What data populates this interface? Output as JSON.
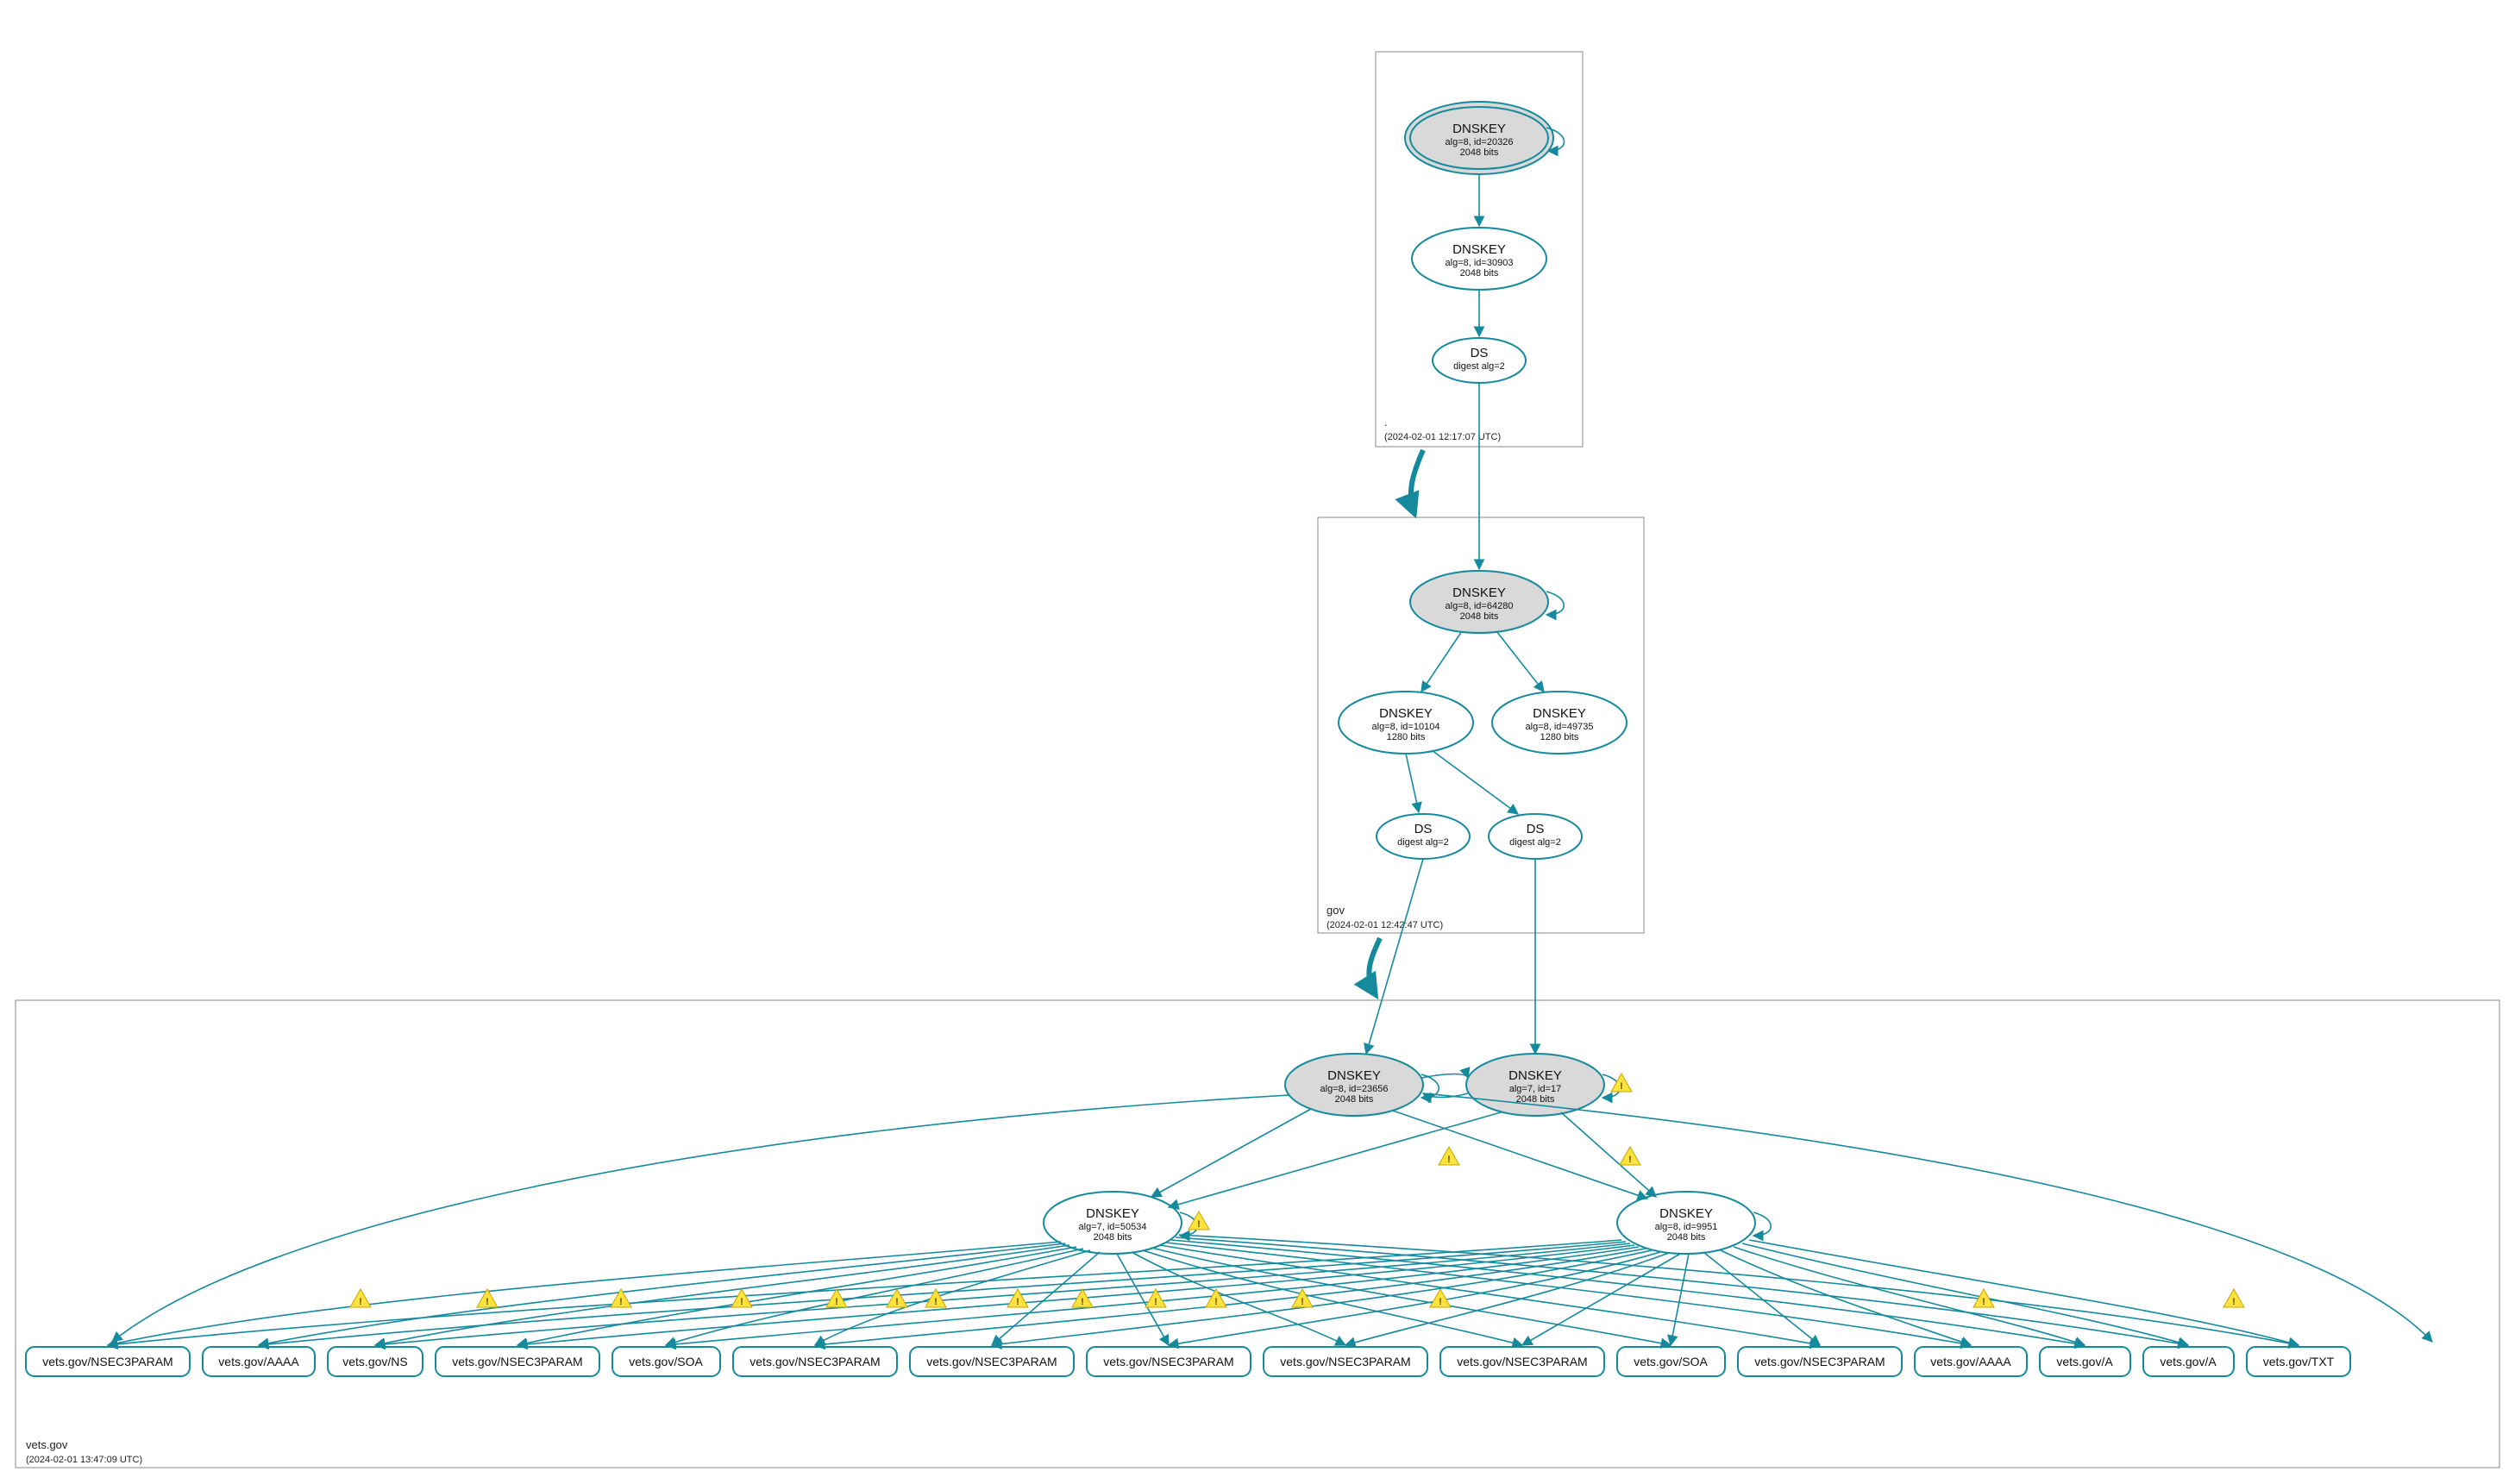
{
  "colors": {
    "accent": "#158a9c",
    "ksk_fill": "#d9d9d9",
    "warn": "#ffe23b"
  },
  "zones": {
    "root": {
      "label": ".",
      "timestamp": "(2024-02-01 12:17:07 UTC)"
    },
    "gov": {
      "label": "gov",
      "timestamp": "(2024-02-01 12:42:47 UTC)"
    },
    "vets": {
      "label": "vets.gov",
      "timestamp": "(2024-02-01 13:47:09 UTC)"
    }
  },
  "nodes": {
    "root_ksk": {
      "title": "DNSKEY",
      "line1": "alg=8, id=20326",
      "line2": "2048 bits"
    },
    "root_zsk": {
      "title": "DNSKEY",
      "line1": "alg=8, id=30903",
      "line2": "2048 bits"
    },
    "root_ds": {
      "title": "DS",
      "line1": "digest alg=2",
      "line2": ""
    },
    "gov_ksk": {
      "title": "DNSKEY",
      "line1": "alg=8, id=64280",
      "line2": "2048 bits"
    },
    "gov_zsk1": {
      "title": "DNSKEY",
      "line1": "alg=8, id=10104",
      "line2": "1280 bits"
    },
    "gov_zsk2": {
      "title": "DNSKEY",
      "line1": "alg=8, id=49735",
      "line2": "1280 bits"
    },
    "gov_ds1": {
      "title": "DS",
      "line1": "digest alg=2",
      "line2": ""
    },
    "gov_ds2": {
      "title": "DS",
      "line1": "digest alg=2",
      "line2": ""
    },
    "vets_ksk1": {
      "title": "DNSKEY",
      "line1": "alg=8, id=23656",
      "line2": "2048 bits"
    },
    "vets_ksk2": {
      "title": "DNSKEY",
      "line1": "alg=7, id=17",
      "line2": "2048 bits"
    },
    "vets_zsk1": {
      "title": "DNSKEY",
      "line1": "alg=7, id=50534",
      "line2": "2048 bits"
    },
    "vets_zsk2": {
      "title": "DNSKEY",
      "line1": "alg=8, id=9951",
      "line2": "2048 bits"
    }
  },
  "rrsets": {
    "r0": "vets.gov/NSEC3PARAM",
    "r1": "vets.gov/AAAA",
    "r2": "vets.gov/NS",
    "r3": "vets.gov/NSEC3PARAM",
    "r4": "vets.gov/SOA",
    "r5": "vets.gov/NSEC3PARAM",
    "r6": "vets.gov/NSEC3PARAM",
    "r7": "vets.gov/NSEC3PARAM",
    "r8": "vets.gov/NSEC3PARAM",
    "r9": "vets.gov/NSEC3PARAM",
    "r10": "vets.gov/SOA",
    "r11": "vets.gov/NSEC3PARAM",
    "r12": "vets.gov/AAAA",
    "r13": "vets.gov/A",
    "r14": "vets.gov/A",
    "r15": "vets.gov/TXT"
  }
}
